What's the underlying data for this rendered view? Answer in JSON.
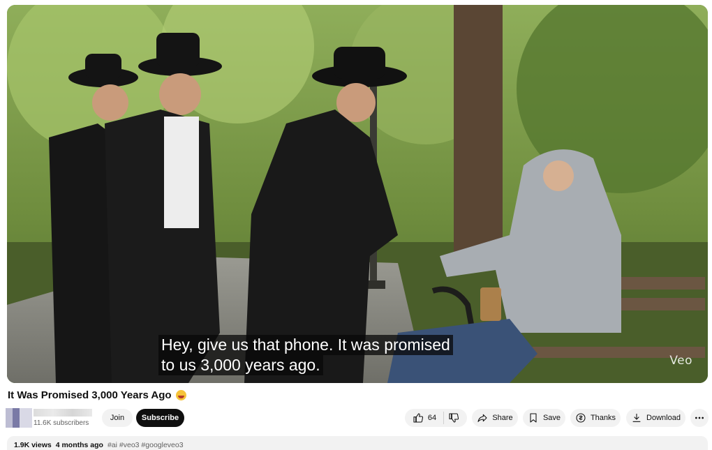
{
  "video": {
    "caption_line1": "Hey, give us that phone. It was promised",
    "caption_line2": "to us 3,000 years ago.",
    "watermark": "Veo"
  },
  "title": "It Was Promised 3,000 Years Ago",
  "channel": {
    "subscribers": "11.6K subscribers",
    "join_label": "Join",
    "subscribe_label": "Subscribe"
  },
  "actions": {
    "like_count": "64",
    "share_label": "Share",
    "save_label": "Save",
    "thanks_label": "Thanks",
    "download_label": "Download"
  },
  "description": {
    "views": "1.9K views",
    "age": "4 months ago",
    "tags": "#ai #veo3 #googleveo3"
  },
  "icons": [
    "like-icon",
    "dislike-icon",
    "share-icon",
    "save-icon",
    "thanks-icon",
    "download-icon",
    "more-icon"
  ],
  "colors": {
    "subscribe_bg": "#0f0f0f",
    "button_bg": "#f2f2f2",
    "text": "#0f0f0f",
    "muted": "#606060"
  }
}
